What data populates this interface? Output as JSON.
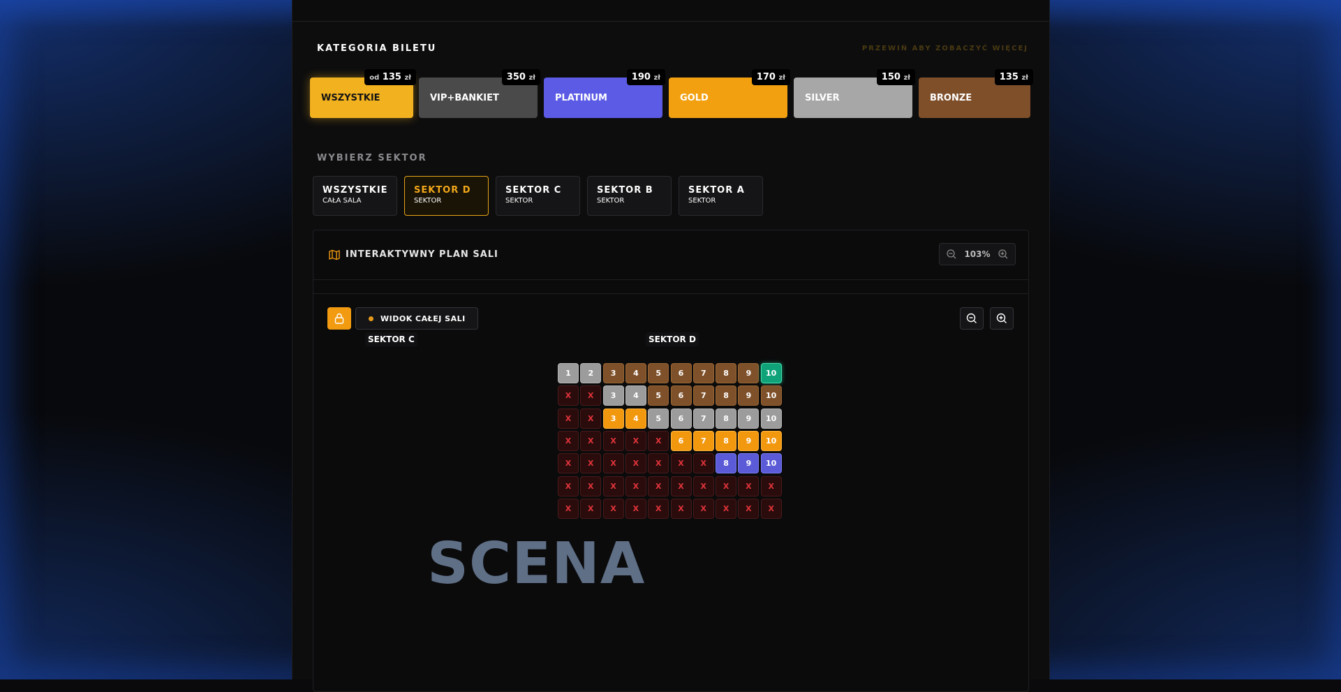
{
  "ticket_category": {
    "title": "KATEGORIA BILETU",
    "hint": "PRZEWIŃ ABY ZOBACZYĆ WIĘCEJ",
    "cards": [
      {
        "label": "WSZYSTKIE",
        "price_prefix": "od",
        "price": "135",
        "currency": "zł",
        "bg": "#f2b21f",
        "fg": "#141414"
      },
      {
        "label": "VIP+BANKIET",
        "price_prefix": "",
        "price": "350",
        "currency": "zł",
        "bg": "#4a4a4a",
        "fg": "#ffffff"
      },
      {
        "label": "PLATINUM",
        "price_prefix": "",
        "price": "190",
        "currency": "zł",
        "bg": "#5b5be6",
        "fg": "#ffffff"
      },
      {
        "label": "GOLD",
        "price_prefix": "",
        "price": "170",
        "currency": "zł",
        "bg": "#f2a010",
        "fg": "#ffffff"
      },
      {
        "label": "SILVER",
        "price_prefix": "",
        "price": "150",
        "currency": "zł",
        "bg": "#a7a7a7",
        "fg": "#ffffff"
      },
      {
        "label": "BRONZE",
        "price_prefix": "",
        "price": "135",
        "currency": "zł",
        "bg": "#7f4f2a",
        "fg": "#ffffff"
      }
    ]
  },
  "sector_select": {
    "title": "WYBIERZ SEKTOR",
    "cards": [
      {
        "name": "WSZYSTKIE",
        "sub": "CAŁA SALA",
        "active": false
      },
      {
        "name": "SEKTOR D",
        "sub": "SEKTOR",
        "active": true
      },
      {
        "name": "SEKTOR C",
        "sub": "SEKTOR",
        "active": false
      },
      {
        "name": "SEKTOR B",
        "sub": "SEKTOR",
        "active": false
      },
      {
        "name": "SEKTOR A",
        "sub": "SEKTOR",
        "active": false
      }
    ]
  },
  "map": {
    "title": "INTERAKTYWNY PLAN SALI",
    "zoom": "103%",
    "view_button": "WIDOK CAŁEJ SALI",
    "sector_labels": [
      "SEKTOR C",
      "SEKTOR D"
    ],
    "stage": "SCENA"
  },
  "colors": {
    "accent": "#f29b11",
    "bronze": "#7f512a",
    "silver": "#9c9c9c",
    "gold": "#f2980f",
    "platinum": "#5b5bd8",
    "selected": "#10a37a",
    "taken": "#2a0c0d"
  },
  "seats": [
    [
      [
        "silver",
        "1"
      ],
      [
        "silver",
        "2"
      ],
      [
        "bronze",
        "3"
      ],
      [
        "bronze",
        "4"
      ],
      [
        "bronze",
        "5"
      ],
      [
        "bronze",
        "6"
      ],
      [
        "bronze",
        "7"
      ],
      [
        "bronze",
        "8"
      ],
      [
        "bronze",
        "9"
      ],
      [
        "selected",
        "10"
      ]
    ],
    [
      [
        "taken",
        "X"
      ],
      [
        "taken",
        "X"
      ],
      [
        "silver",
        "3"
      ],
      [
        "silver",
        "4"
      ],
      [
        "bronze",
        "5"
      ],
      [
        "bronze",
        "6"
      ],
      [
        "bronze",
        "7"
      ],
      [
        "bronze",
        "8"
      ],
      [
        "bronze",
        "9"
      ],
      [
        "bronze",
        "10"
      ]
    ],
    [
      [
        "taken",
        "X"
      ],
      [
        "taken",
        "X"
      ],
      [
        "gold",
        "3"
      ],
      [
        "gold",
        "4"
      ],
      [
        "silver",
        "5"
      ],
      [
        "silver",
        "6"
      ],
      [
        "silver",
        "7"
      ],
      [
        "silver",
        "8"
      ],
      [
        "silver",
        "9"
      ],
      [
        "silver",
        "10"
      ]
    ],
    [
      [
        "taken",
        "X"
      ],
      [
        "taken",
        "X"
      ],
      [
        "taken",
        "X"
      ],
      [
        "taken",
        "X"
      ],
      [
        "taken",
        "X"
      ],
      [
        "gold",
        "6"
      ],
      [
        "gold",
        "7"
      ],
      [
        "gold",
        "8"
      ],
      [
        "gold",
        "9"
      ],
      [
        "gold",
        "10"
      ]
    ],
    [
      [
        "taken",
        "X"
      ],
      [
        "taken",
        "X"
      ],
      [
        "taken",
        "X"
      ],
      [
        "taken",
        "X"
      ],
      [
        "taken",
        "X"
      ],
      [
        "taken",
        "X"
      ],
      [
        "taken",
        "X"
      ],
      [
        "platinum",
        "8"
      ],
      [
        "platinum",
        "9"
      ],
      [
        "platinum",
        "10"
      ]
    ],
    [
      [
        "taken",
        "X"
      ],
      [
        "taken",
        "X"
      ],
      [
        "taken",
        "X"
      ],
      [
        "taken",
        "X"
      ],
      [
        "taken",
        "X"
      ],
      [
        "taken",
        "X"
      ],
      [
        "taken",
        "X"
      ],
      [
        "taken",
        "X"
      ],
      [
        "taken",
        "X"
      ],
      [
        "taken",
        "X"
      ]
    ],
    [
      [
        "taken",
        "X"
      ],
      [
        "taken",
        "X"
      ],
      [
        "taken",
        "X"
      ],
      [
        "taken",
        "X"
      ],
      [
        "taken",
        "X"
      ],
      [
        "taken",
        "X"
      ],
      [
        "taken",
        "X"
      ],
      [
        "taken",
        "X"
      ],
      [
        "taken",
        "X"
      ],
      [
        "taken",
        "X"
      ]
    ]
  ]
}
